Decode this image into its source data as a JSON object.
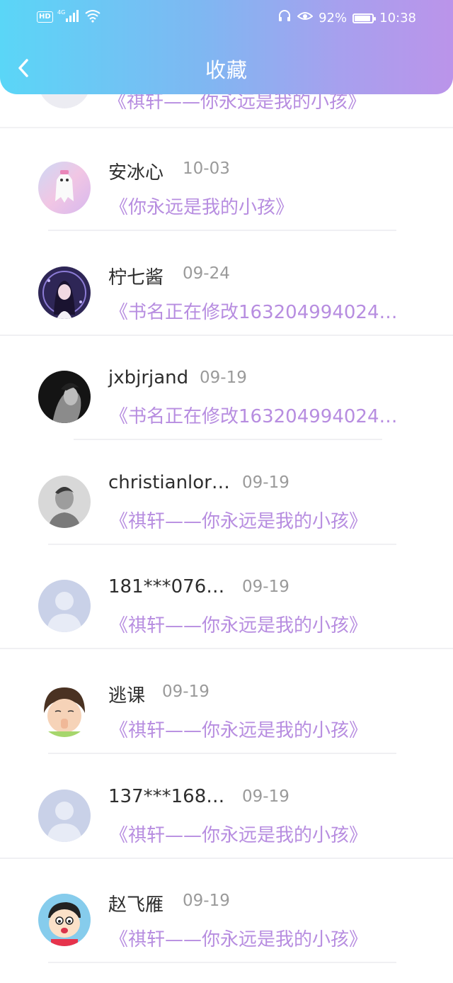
{
  "status_bar": {
    "hd_label": "HD",
    "network": "4G",
    "battery_percent": "92%",
    "battery_level": 0.92,
    "time": "10:38"
  },
  "header": {
    "title": "收藏",
    "background_from": "#5ad6f7",
    "background_to": "#bb94ea"
  },
  "partial_item": {
    "book": "《祺轩——你永远是我的小孩》"
  },
  "items": [
    {
      "name": "安冰心",
      "date": "10-03",
      "book": "《你永远是我的小孩》",
      "avatar": "ghost-plush-avatar"
    },
    {
      "name": "柠七酱",
      "date": "09-24",
      "book": "《书名正在修改163204994024…",
      "avatar": "anime-girl-avatar"
    },
    {
      "name": "jxbjrjand",
      "date": "09-19",
      "book": "《书名正在修改163204994024…",
      "avatar": "dark-portrait-avatar"
    },
    {
      "name": "christianlor…",
      "date": "09-19",
      "book": "《祺轩——你永远是我的小孩》",
      "avatar": "bw-portrait-avatar"
    },
    {
      "name": "181***076…",
      "date": "09-19",
      "book": "《祺轩——你永远是我的小孩》",
      "avatar": "default-user-avatar"
    },
    {
      "name": "逃课",
      "date": "09-19",
      "book": "《祺轩——你永远是我的小孩》",
      "avatar": "child-photo-avatar"
    },
    {
      "name": "137***168…",
      "date": "09-19",
      "book": "《祺轩——你永远是我的小孩》",
      "avatar": "default-user-avatar"
    },
    {
      "name": "赵飞雁",
      "date": "09-19",
      "book": "《祺轩——你永远是我的小孩》",
      "avatar": "cartoon-boy-avatar"
    }
  ],
  "colors": {
    "accent_text": "#b78de0",
    "name_text": "#2e2e2e",
    "date_text": "#9a9a9a"
  }
}
